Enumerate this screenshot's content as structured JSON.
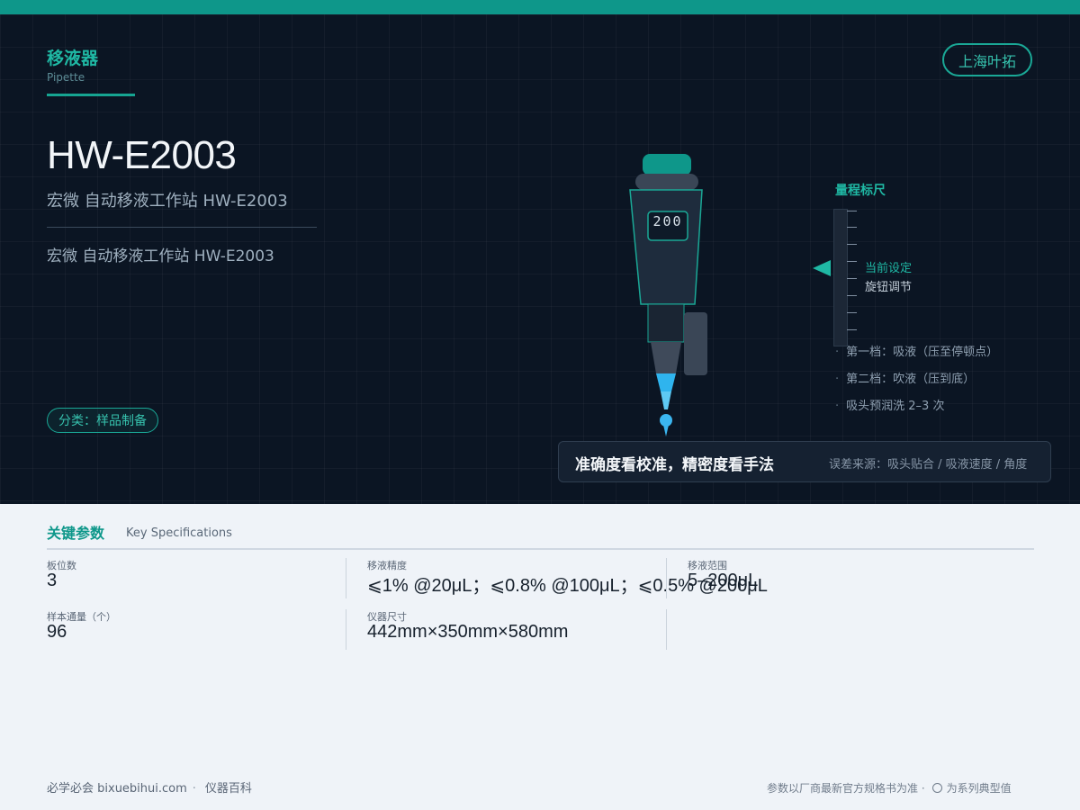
{
  "category": {
    "cn": "移液器",
    "en": "Pipette"
  },
  "brand": "上海叶拓",
  "model": "HW-E2003",
  "subtitle": "宏微 自动移液工作站 HW-E2003",
  "description": "宏微 自动移液工作站 HW-E2003",
  "tag": "分类：样品制备",
  "pipette": {
    "display": "200"
  },
  "scale": {
    "title": "量程标尺",
    "current_label": "当前设定",
    "knob_label": "旋钮调节"
  },
  "steps": [
    "第一档：吸液（压至停顿点）",
    "第二档：吹液（压到底）",
    "吸头预润洗 2–3 次"
  ],
  "info": {
    "tagline": "准确度看校准，精密度看手法",
    "error_sources": "误差来源：吸头贴合 / 吸液速度 / 角度"
  },
  "specs": {
    "title": "关键参数",
    "title_en": "Key Specifications",
    "items": [
      {
        "label": "板位数",
        "value": "3"
      },
      {
        "label": "移液精度",
        "value": "⩽1% @20μL；⩽0.8% @100μL；⩽0.5% @200μL"
      },
      {
        "label": "移液范围",
        "value": "5–200μL"
      },
      {
        "label": "样本通量（个）",
        "value": "96"
      },
      {
        "label": "仪器尺寸",
        "value": "442mm×350mm×580mm"
      }
    ]
  },
  "footer": {
    "site": "必学必会 bixuebihui.com",
    "dot": "·",
    "section": "仪器百科",
    "note": "参数以厂商最新官方规格书为准 ·",
    "legend": "为系列典型值"
  },
  "colors": {
    "accent": "#0e978a",
    "hero_bg": "#0b1523",
    "tip_blue": "#3bb6f0"
  }
}
